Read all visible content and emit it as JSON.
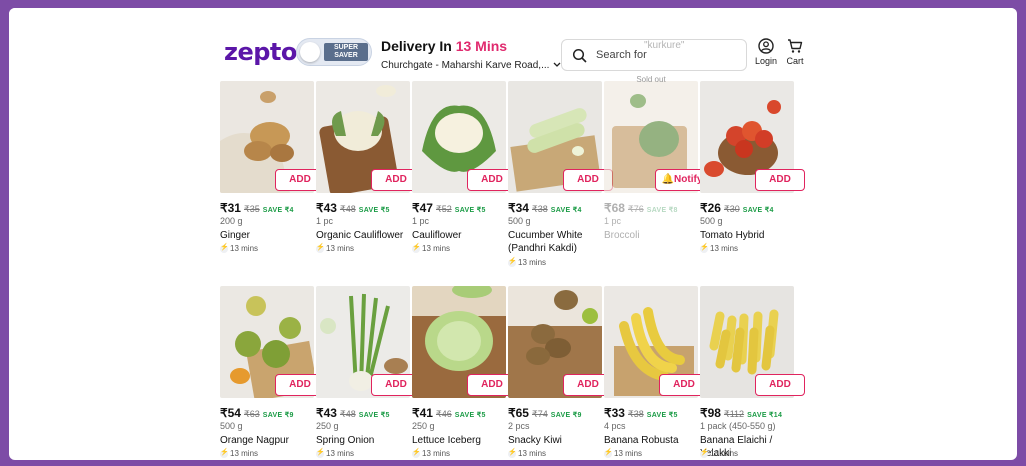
{
  "header": {
    "logo": "zepto",
    "super_saver_label": "SUPER SAVER",
    "delivery_title": "Delivery In ",
    "delivery_time": "13 Mins",
    "location": "Churchgate - Maharshi Karve Road,...",
    "search_placeholder": "Search for",
    "search_hint": "\"kurkure\"",
    "login_label": "Login",
    "cart_label": "Cart"
  },
  "colors": {
    "brand": "#5b16a8",
    "accent": "#e0245e",
    "save_green": "#1a9b45",
    "page_bg": "#7d4ca6"
  },
  "products": [
    {
      "name": "Ginger",
      "price": "₹31",
      "mrp": "₹35",
      "save": "SAVE ₹4",
      "qty": "200 g",
      "eta": "13 mins",
      "button": "ADD",
      "soldout": ""
    },
    {
      "name": "Organic Cauliflower",
      "price": "₹43",
      "mrp": "₹48",
      "save": "SAVE ₹5",
      "qty": "1 pc",
      "eta": "13 mins",
      "button": "ADD",
      "soldout": ""
    },
    {
      "name": "Cauliflower",
      "price": "₹47",
      "mrp": "₹52",
      "save": "SAVE ₹5",
      "qty": "1 pc",
      "eta": "13 mins",
      "button": "ADD",
      "soldout": ""
    },
    {
      "name": "Cucumber White (Pandhri Kakdi)",
      "price": "₹34",
      "mrp": "₹38",
      "save": "SAVE ₹4",
      "qty": "500 g",
      "eta": "13 mins",
      "button": "ADD",
      "soldout": ""
    },
    {
      "name": "Broccoli",
      "price": "₹68",
      "mrp": "₹76",
      "save": "SAVE ₹8",
      "qty": "1 pc",
      "eta": "",
      "button": "Notify",
      "soldout": "Sold out"
    },
    {
      "name": "Tomato Hybrid",
      "price": "₹26",
      "mrp": "₹30",
      "save": "SAVE ₹4",
      "qty": "500 g",
      "eta": "13 mins",
      "button": "ADD",
      "soldout": ""
    },
    {
      "name": "Orange Nagpur",
      "price": "₹54",
      "mrp": "₹63",
      "save": "SAVE ₹9",
      "qty": "500 g",
      "eta": "13 mins",
      "button": "ADD",
      "soldout": ""
    },
    {
      "name": "Spring Onion",
      "price": "₹43",
      "mrp": "₹48",
      "save": "SAVE ₹5",
      "qty": "250 g",
      "eta": "13 mins",
      "button": "ADD",
      "soldout": ""
    },
    {
      "name": "Lettuce Iceberg",
      "price": "₹41",
      "mrp": "₹46",
      "save": "SAVE ₹5",
      "qty": "250 g",
      "eta": "13 mins",
      "button": "ADD",
      "soldout": ""
    },
    {
      "name": "Snacky Kiwi",
      "price": "₹65",
      "mrp": "₹74",
      "save": "SAVE ₹9",
      "qty": "2 pcs",
      "eta": "13 mins",
      "button": "ADD",
      "soldout": ""
    },
    {
      "name": "Banana Robusta",
      "price": "₹33",
      "mrp": "₹38",
      "save": "SAVE ₹5",
      "qty": "4 pcs",
      "eta": "13 mins",
      "button": "ADD",
      "soldout": ""
    },
    {
      "name": "Banana Elaichi / Yelakki",
      "price": "₹98",
      "mrp": "₹112",
      "save": "SAVE ₹14",
      "qty": "1 pack (450-550 g)",
      "eta": "13 mins",
      "button": "ADD",
      "soldout": ""
    }
  ]
}
